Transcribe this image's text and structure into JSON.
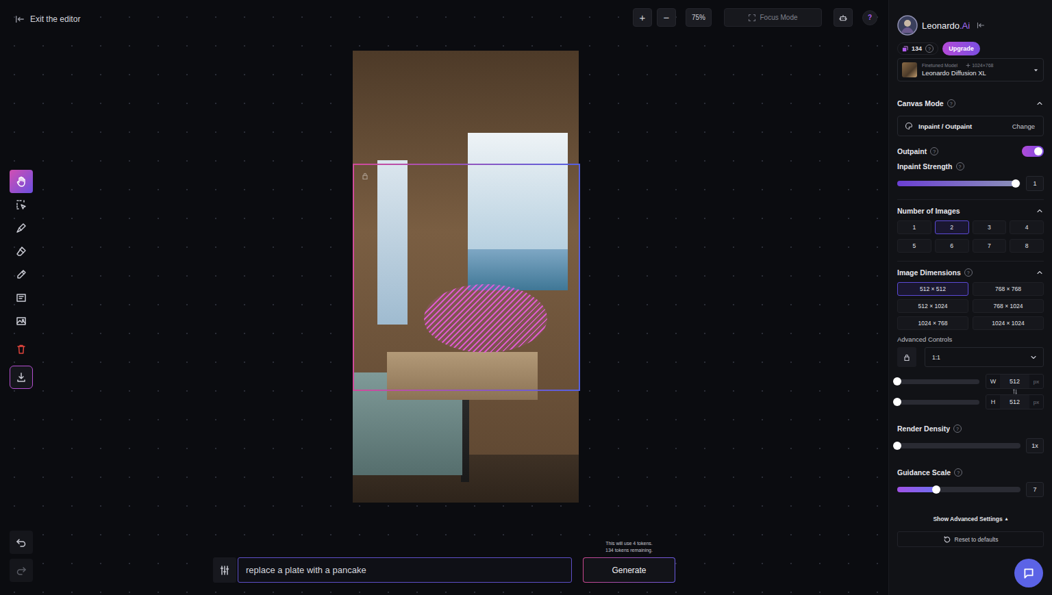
{
  "help_glyph": "?",
  "topbar": {
    "exit_label": "Exit the editor",
    "zoom_in": "+",
    "zoom_out": "−",
    "zoom": "75%",
    "focus_mode": "Focus Mode"
  },
  "tools": [
    {
      "kind": "pan",
      "selected": true
    },
    {
      "kind": "select",
      "selected": false
    },
    {
      "kind": "mask",
      "selected": false
    },
    {
      "kind": "erase",
      "selected": false
    },
    {
      "kind": "draw",
      "selected": false
    },
    {
      "kind": "sketch",
      "selected": false
    },
    {
      "kind": "image",
      "selected": false
    },
    {
      "kind": "delete",
      "selected": false
    },
    {
      "kind": "download",
      "selected": false
    }
  ],
  "history": [
    {
      "kind": "undo",
      "disabled": false
    },
    {
      "kind": "redo",
      "disabled": true
    }
  ],
  "prompt": {
    "value": "replace a plate with a pancake",
    "cost_line": "This will use 4 tokens.",
    "remaining_line": "134 tokens remaining.",
    "generate": "Generate"
  },
  "sidebar": {
    "brand": {
      "name": "Leonardo",
      "suffix": ".Ai"
    },
    "tokens": "134",
    "upgrade": "Upgrade",
    "model": {
      "caption": "Finetuned Model",
      "size": "1024×768",
      "name": "Leonardo Diffusion XL"
    },
    "canvas_mode": {
      "title": "Canvas Mode",
      "expanded": true,
      "value": "Inpaint / Outpaint",
      "action": "Change"
    },
    "outpaint": {
      "label": "Outpaint",
      "on": true
    },
    "inpaint_strength": {
      "label": "Inpaint Strength",
      "level": 0.96,
      "reading": "1"
    },
    "number_of_images": {
      "title": "Number of Images",
      "expanded": true,
      "options": [
        {
          "label": "1",
          "selected": false
        },
        {
          "label": "2",
          "selected": true
        },
        {
          "label": "3",
          "selected": false
        },
        {
          "label": "4",
          "selected": false
        },
        {
          "label": "5",
          "selected": false
        },
        {
          "label": "6",
          "selected": false
        },
        {
          "label": "7",
          "selected": false
        },
        {
          "label": "8",
          "selected": false
        }
      ]
    },
    "image_dimensions": {
      "title": "Image Dimensions",
      "expanded": true,
      "options": [
        {
          "label": "512 × 512",
          "selected": true
        },
        {
          "label": "768 × 768",
          "selected": false
        },
        {
          "label": "512 × 1024",
          "selected": false
        },
        {
          "label": "768 × 1024",
          "selected": false
        },
        {
          "label": "1024 × 768",
          "selected": false
        },
        {
          "label": "1024 × 1024",
          "selected": false
        }
      ]
    },
    "advanced_controls": {
      "label": "Advanced Controls",
      "ratio": "1:1"
    },
    "sizes": [
      {
        "label": "W",
        "value": "512",
        "unit": "px",
        "level": 0
      },
      {
        "label": "H",
        "value": "512",
        "unit": "px",
        "level": 0
      }
    ],
    "render_density": {
      "label": "Render Density",
      "level": 0,
      "reading": "1x"
    },
    "guidance_scale": {
      "label": "Guidance Scale",
      "level": 0.315,
      "reading": "7"
    },
    "show_advanced": {
      "label": "Show Advanced Settings",
      "caret": "▴"
    },
    "reset": "Reset to defaults"
  }
}
